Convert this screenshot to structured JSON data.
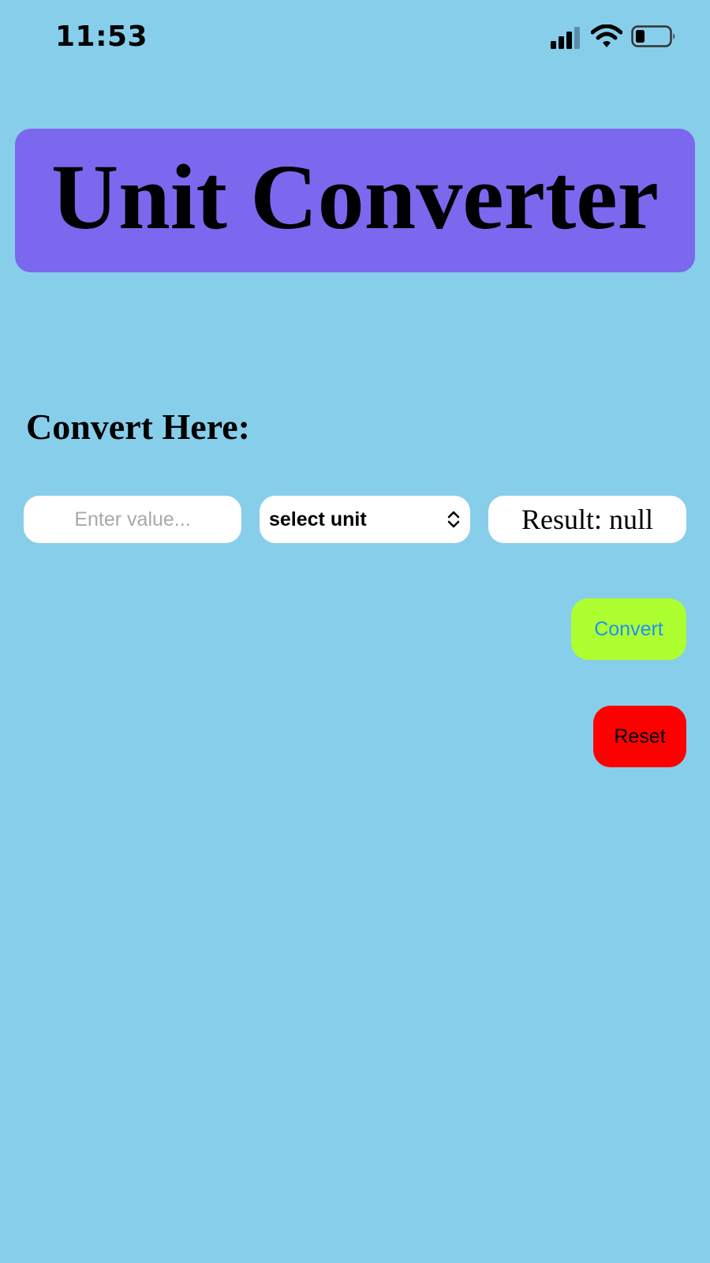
{
  "status_bar": {
    "time": "11:53",
    "icons": [
      "signal-icon",
      "wifi-icon",
      "battery-icon"
    ]
  },
  "header": {
    "title": "Unit Converter"
  },
  "form": {
    "heading": "Convert Here:",
    "value_input": {
      "value": "",
      "placeholder": "Enter value..."
    },
    "unit_select": {
      "selected": "select unit"
    },
    "result_text": "Result: null",
    "convert_label": "Convert",
    "reset_label": "Reset"
  },
  "colors": {
    "background": "#87CEEB",
    "header": "#7B68EE",
    "convert_button": "#ADFF2F",
    "convert_text": "#1E90FF",
    "reset_button": "#FF0000"
  }
}
